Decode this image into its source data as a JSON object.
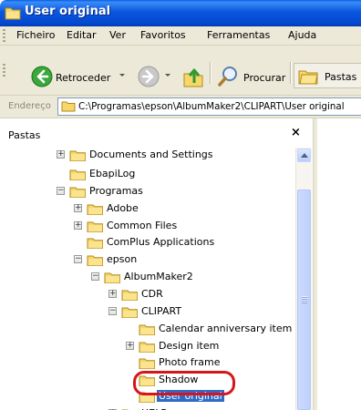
{
  "window": {
    "title": "User original"
  },
  "menu": [
    "Ficheiro",
    "Editar",
    "Ver",
    "Favoritos",
    "Ferramentas",
    "Ajuda"
  ],
  "toolbar": {
    "back": "Retroceder",
    "search": "Procurar",
    "folders": "Pastas"
  },
  "address": {
    "label": "Endereço",
    "path": "C:\\Programas\\epson\\AlbumMaker2\\CLIPART\\User original"
  },
  "pane": {
    "title": "Pastas",
    "close": "×"
  },
  "tree": [
    {
      "label": "Documents and Settings",
      "expander": "+"
    },
    {
      "label": "EbapiLog",
      "expander": ""
    },
    {
      "label": "Programas",
      "expander": "−"
    },
    {
      "label": "Adobe",
      "expander": "+"
    },
    {
      "label": "Common Files",
      "expander": "+"
    },
    {
      "label": "ComPlus Applications",
      "expander": ""
    },
    {
      "label": "epson",
      "expander": "−"
    },
    {
      "label": "AlbumMaker2",
      "expander": "−"
    },
    {
      "label": "CDR",
      "expander": "+"
    },
    {
      "label": "CLIPART",
      "expander": "−"
    },
    {
      "label": "Calendar anniversary item",
      "expander": ""
    },
    {
      "label": "Design item",
      "expander": "+"
    },
    {
      "label": "Photo frame",
      "expander": ""
    },
    {
      "label": "Shadow",
      "expander": ""
    },
    {
      "label": "User original",
      "expander": "",
      "selected": true
    },
    {
      "label": "HELP",
      "expander": "+"
    }
  ],
  "colors": {
    "titlebar": "#0b56de",
    "selection": "#316ac5",
    "highlight": "#d7141b"
  }
}
